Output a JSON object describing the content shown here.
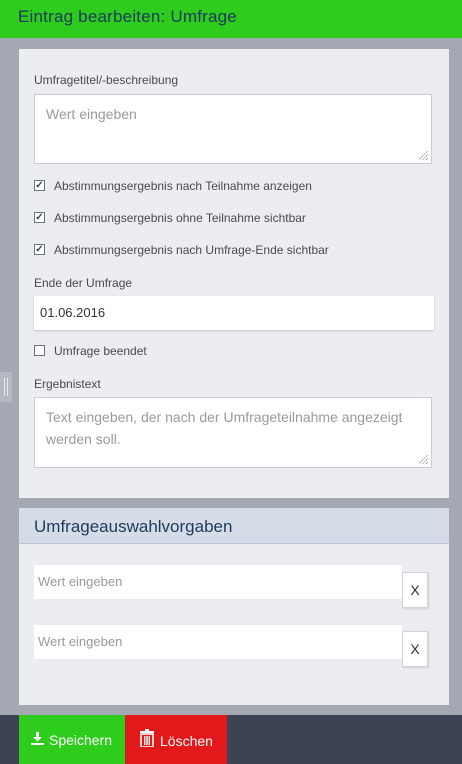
{
  "header": {
    "title": "Eintrag bearbeiten: Umfrage"
  },
  "form": {
    "title_label": "Umfragetitel/-beschreibung",
    "title_placeholder": "Wert eingeben",
    "checkboxes": [
      {
        "label": "Abstimmungsergebnis nach Teilnahme anzeigen",
        "checked": true
      },
      {
        "label": "Abstimmungsergebnis ohne Teilnahme sichtbar",
        "checked": true
      },
      {
        "label": "Abstimmungsergebnis nach Umfrage-Ende sichtbar",
        "checked": true
      }
    ],
    "end_label": "Ende der Umfrage",
    "end_value": "01.06.2016",
    "ended": {
      "label": "Umfrage beendet",
      "checked": false
    },
    "result_label": "Ergebnistext",
    "result_placeholder": "Text eingeben, der nach der Umfrageteilnahme angezeigt werden soll."
  },
  "options": {
    "header": "Umfrageauswahlvorgaben",
    "items": [
      {
        "placeholder": "Wert eingeben",
        "remove_label": "X"
      },
      {
        "placeholder": "Wert eingeben",
        "remove_label": "X"
      }
    ]
  },
  "footer": {
    "save_label": "Speichern",
    "delete_label": "Löschen"
  },
  "colors": {
    "accent_green": "#2ecc1c",
    "danger_red": "#e3181a",
    "title_blue": "#1e3a5a",
    "footer_bg": "#3d4353"
  }
}
